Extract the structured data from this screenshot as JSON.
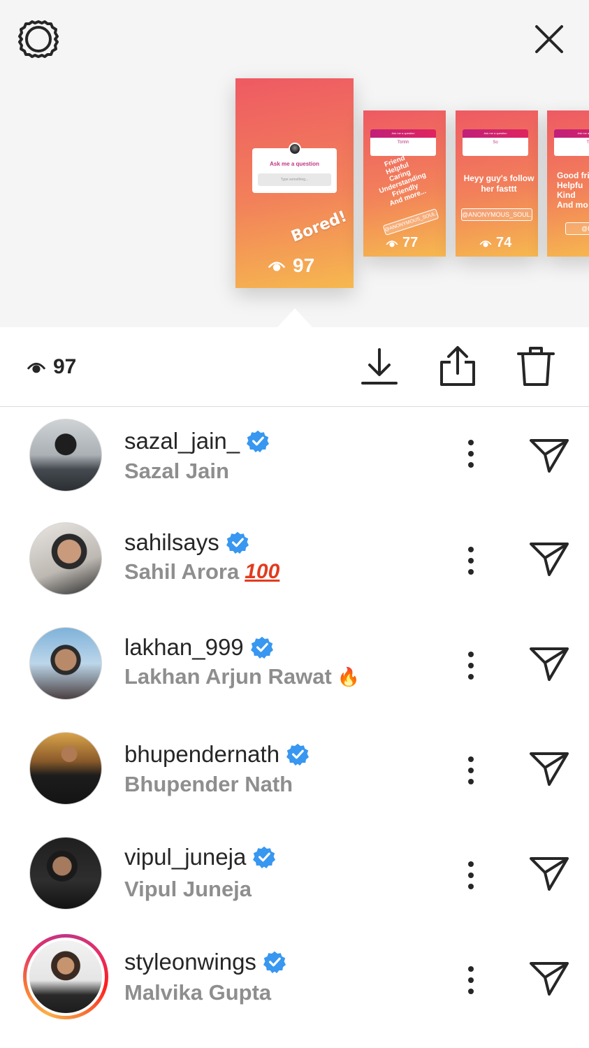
{
  "header": {
    "settings_icon": "gear-icon",
    "close_icon": "close-icon"
  },
  "stories": {
    "main": {
      "question_title": "Ask me a question",
      "question_placeholder": "Type something...",
      "sticker_text": "Bored!",
      "views": "97"
    },
    "thumb1": {
      "header": "Ask me a question",
      "answer": "Tbhhh",
      "body": "Friend\nHelpful\nCaring\nUnderstanding\nFriendly\nAnd more...",
      "tag": "@ANONYMOUS_SOUL...",
      "views": "77"
    },
    "thumb2": {
      "header": "Ask me a question",
      "answer": "So",
      "body": "Heyy guy's follow her fasttt",
      "tag": "@ANONYMOUS_SOUL...",
      "views": "74"
    },
    "thumb3": {
      "header": "Ask me a question",
      "answer": "Th",
      "body": "Good frie\nHelpfu\nKind\nAnd mo",
      "tag": "@BHA"
    }
  },
  "toolbar": {
    "views": "97",
    "icons": [
      "eye-icon",
      "download-icon",
      "share-icon",
      "trash-icon"
    ]
  },
  "viewers": [
    {
      "username": "sazal_jain_",
      "full_name": "Sazal Jain",
      "verified": true,
      "emoji": ""
    },
    {
      "username": "sahilsays",
      "full_name": "Sahil Arora",
      "verified": true,
      "emoji": "100"
    },
    {
      "username": "lakhan_999",
      "full_name": "Lakhan Arjun Rawat",
      "verified": true,
      "emoji": "🔥"
    },
    {
      "username": "bhupendernath",
      "full_name": "Bhupender Nath",
      "verified": true,
      "emoji": ""
    },
    {
      "username": "vipul_juneja",
      "full_name": "Vipul Juneja",
      "verified": true,
      "emoji": ""
    },
    {
      "username": "styleonwings",
      "full_name": "Malvika Gupta",
      "verified": true,
      "emoji": ""
    }
  ],
  "colors": {
    "verified": "#3897f0",
    "story_gradient_top": "#ee5a63",
    "story_gradient_bottom": "#f6b84f",
    "secondary_text": "#8e8e8e"
  }
}
